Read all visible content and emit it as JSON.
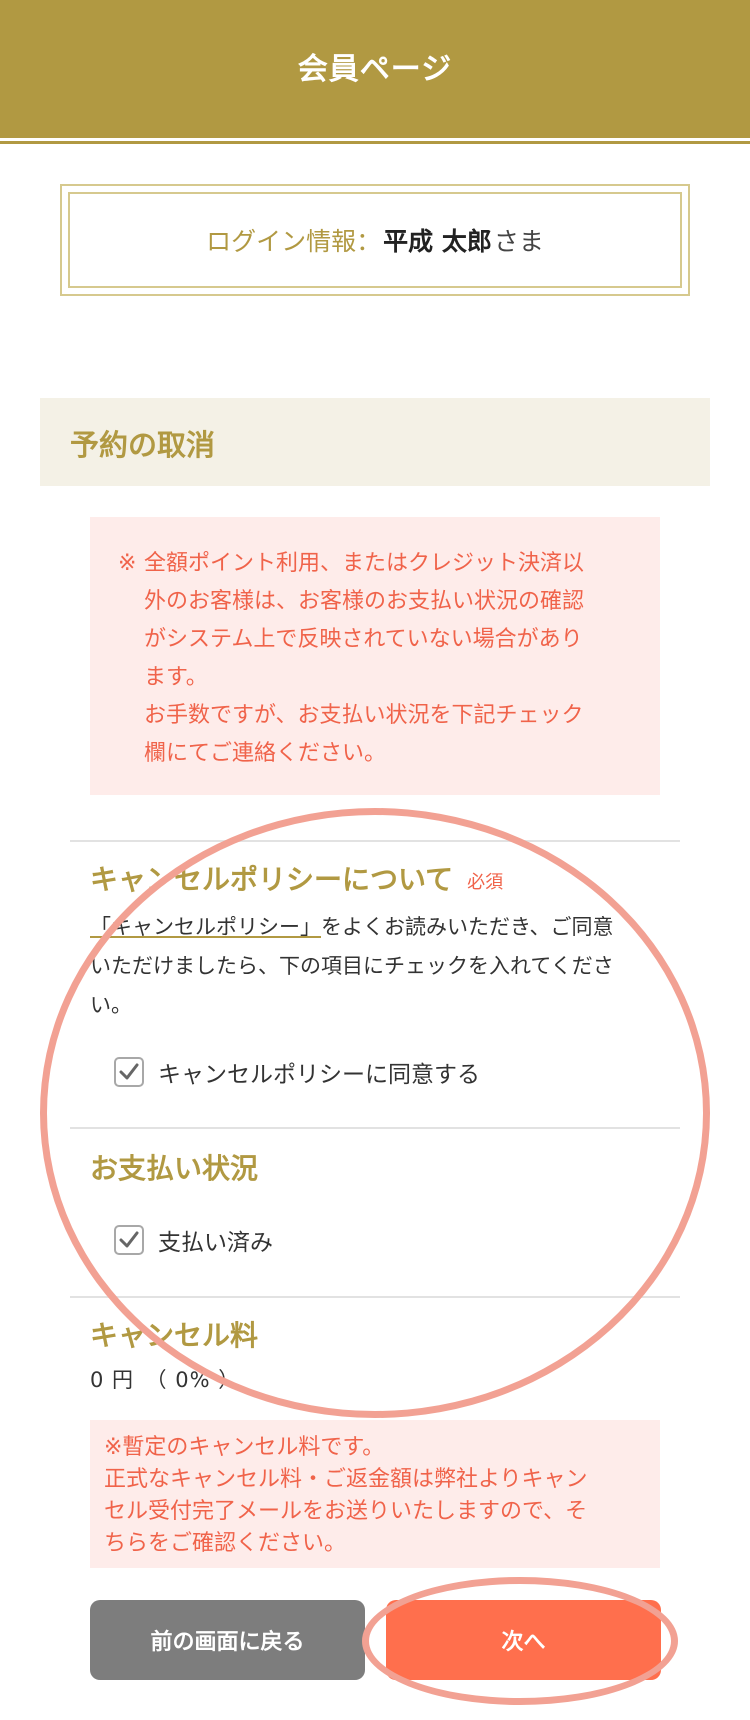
{
  "header": {
    "title": "会員ページ"
  },
  "login": {
    "label": "ログイン情報：",
    "name": "平成 太郎",
    "suffix": "さま"
  },
  "section": {
    "title": "予約の取消"
  },
  "notice": {
    "mark": "※",
    "lines": [
      "全額ポイント利用、またはクレジット決済以",
      "外のお客様は、お客様のお支払い状況の確認",
      "がシステム上で反映されていない場合があり",
      "ます。",
      "お手数ですが、お支払い状況を下記チェック",
      "欄にてご連絡ください。"
    ]
  },
  "policy": {
    "title": "キャンセルポリシーについて",
    "required": "必須",
    "link": "「キャンセルポリシー」",
    "text_line1": "をよくお読みいただき、ご同意",
    "text_line2": "いただけましたら、下の項目にチェックを入れてくださ",
    "text_line3": "い。",
    "checkbox_label": "キャンセルポリシーに同意する",
    "checkbox_checked": true
  },
  "payment": {
    "title": "お支払い状況",
    "checkbox_label": "支払い済み",
    "checkbox_checked": true
  },
  "fee": {
    "title": "キャンセル料",
    "value": "0 円　（ 0% ）",
    "note_lines": [
      "※暫定のキャンセル料です。",
      "正式なキャンセル料・ご返金額は弊社よりキャン",
      "セル受付完了メールをお送りいたしますので、そ",
      "ちらをご確認ください。"
    ]
  },
  "buttons": {
    "back": "前の画面に戻る",
    "next": "次へ"
  },
  "colors": {
    "gold": "#b19942",
    "accent": "#ff6f4d",
    "notice_text": "#f0634a",
    "notice_bg": "#feecea",
    "back_button": "#7d7d7d",
    "annotation": "#f2a193"
  },
  "icons": {
    "checkbox": "check-icon"
  }
}
